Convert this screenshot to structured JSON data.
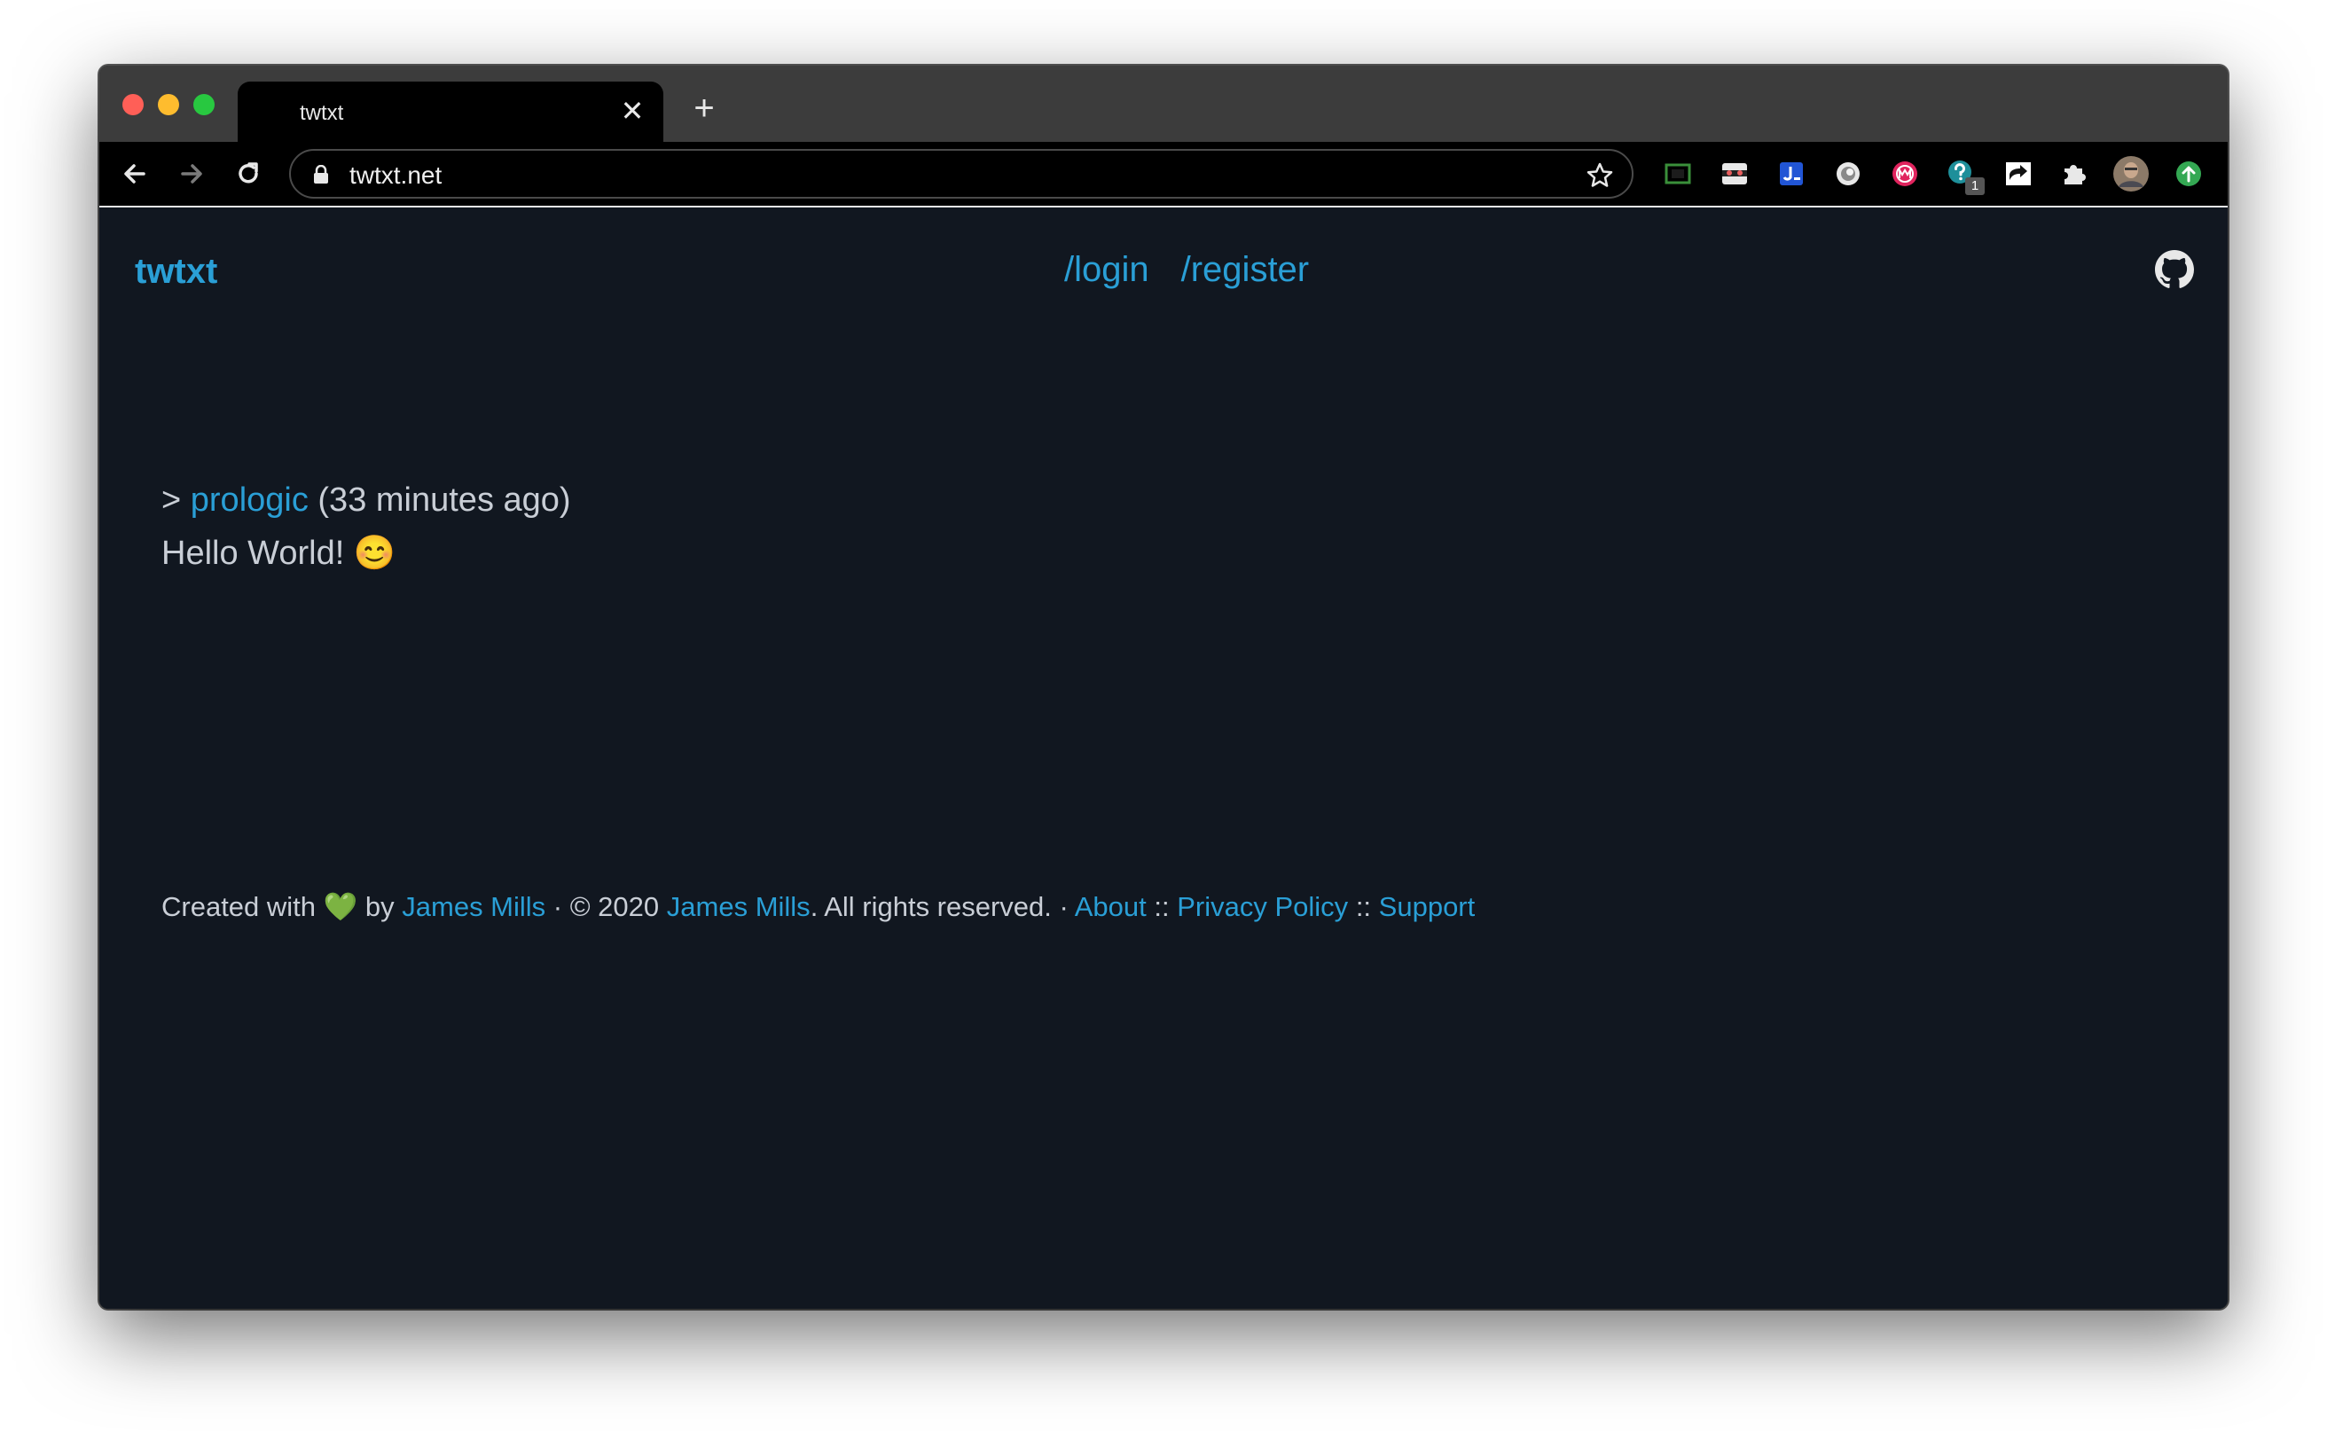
{
  "browser": {
    "tab_title": "twtxt",
    "close_glyph": "✕",
    "new_tab_glyph": "+",
    "url": "twtxt.net",
    "extension_badge": "1",
    "colors": {
      "close_red": "#ff5f57",
      "minimize_yellow": "#febc2e",
      "zoom_green": "#28c840"
    }
  },
  "site": {
    "brand": "twtxt",
    "nav": {
      "login": "/login",
      "register": "/register"
    },
    "github_icon": "github-icon",
    "accent_color": "#2a9fd6",
    "background_color": "#111720"
  },
  "post": {
    "prefix": ">",
    "author": "prologic",
    "time": "(33 minutes ago)",
    "text": "Hello World!",
    "emoji": "😊"
  },
  "footer": {
    "created_with": "Created with",
    "heart": "💚",
    "by": "by",
    "author_link": "James Mills",
    "copyright": "· © 2020",
    "owner_link": "James Mills",
    "rights": ". All rights reserved. ·",
    "about": "About",
    "sep1": "::",
    "privacy": "Privacy Policy",
    "sep2": "::",
    "support": "Support"
  }
}
